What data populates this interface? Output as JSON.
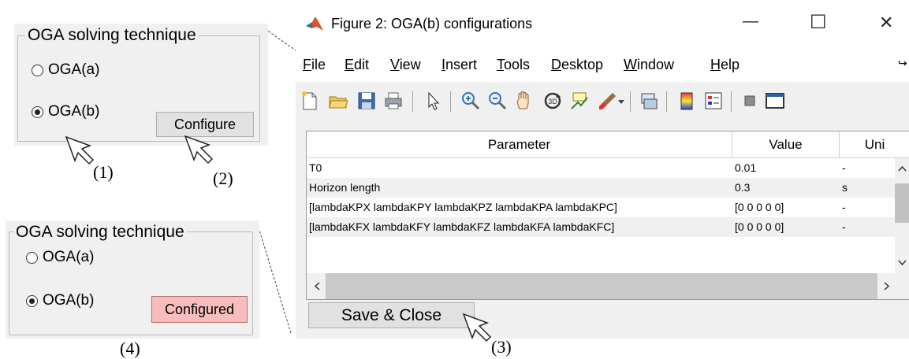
{
  "panel_top": {
    "group_title": "OGA solving technique",
    "option_a": "OGA(a)",
    "option_b": "OGA(b)",
    "selected": "OGA(b)",
    "button_label": "Configure"
  },
  "panel_bottom": {
    "group_title": "OGA solving technique",
    "option_a": "OGA(a)",
    "option_b": "OGA(b)",
    "selected": "OGA(b)",
    "button_label": "Configured",
    "button_color": "#f7bcbc"
  },
  "callouts": {
    "c1": "(1)",
    "c2": "(2)",
    "c3": "(3)",
    "c4": "(4)"
  },
  "figure": {
    "title": "Figure 2: OGA(b) configurations",
    "controls": {
      "minimize": "—",
      "maximize": "☐",
      "close": "✕"
    },
    "menu": [
      {
        "key": "F",
        "rest": "ile"
      },
      {
        "key": "E",
        "rest": "dit"
      },
      {
        "key": "V",
        "rest": "iew"
      },
      {
        "key": "I",
        "rest": "nsert"
      },
      {
        "key": "T",
        "rest": "ools"
      },
      {
        "key": "D",
        "rest": "esktop"
      },
      {
        "key": "W",
        "rest": "indow"
      },
      {
        "key": "H",
        "rest": "elp"
      }
    ],
    "toolbar_icons": [
      "new-figure-icon",
      "open-file-icon",
      "save-icon",
      "print-icon",
      "pointer-icon",
      "zoom-in-icon",
      "zoom-out-icon",
      "pan-icon",
      "rotate-3d-icon",
      "data-cursor-icon",
      "brush-icon",
      "dropdown-icon",
      "link-plot-icon",
      "colorbar-icon",
      "legend-icon",
      "hide-plot-tools-icon",
      "show-plot-tools-icon"
    ],
    "table": {
      "headers": [
        "Parameter",
        "Value",
        "Uni"
      ],
      "rows": [
        [
          "T0",
          "0.01",
          "-"
        ],
        [
          "Horizon length",
          "0.3",
          "s"
        ],
        [
          "[lambdaKPX lambdaKPY lambdaKPZ lambdaKPA lambdaKPC]",
          "[0 0 0 0 0]",
          "-"
        ],
        [
          "[lambdaKFX lambdaKFY lambdaKFZ lambdaKFA lambdaKFC]",
          "[0 0 0 0 0]",
          "-"
        ]
      ]
    },
    "save_button": "Save & Close"
  }
}
